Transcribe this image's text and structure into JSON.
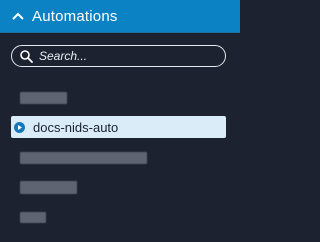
{
  "header": {
    "title": "Automations",
    "chevron_icon": "chevron-up-icon"
  },
  "search": {
    "placeholder": "Search...",
    "value": "",
    "icon": "search-icon"
  },
  "list": {
    "items": [
      {
        "label": "",
        "blurred": true
      },
      {
        "label": "docs-nids-auto",
        "selected": true,
        "icon": "play-circle-icon"
      },
      {
        "label": "",
        "blurred": true
      },
      {
        "label": "",
        "blurred": true
      },
      {
        "label": "",
        "blurred": true
      }
    ]
  },
  "colors": {
    "header_bg": "#0b82c4",
    "panel_bg": "#1c2230",
    "selected_bg": "#d9ecf8",
    "accent": "#1677b8"
  }
}
